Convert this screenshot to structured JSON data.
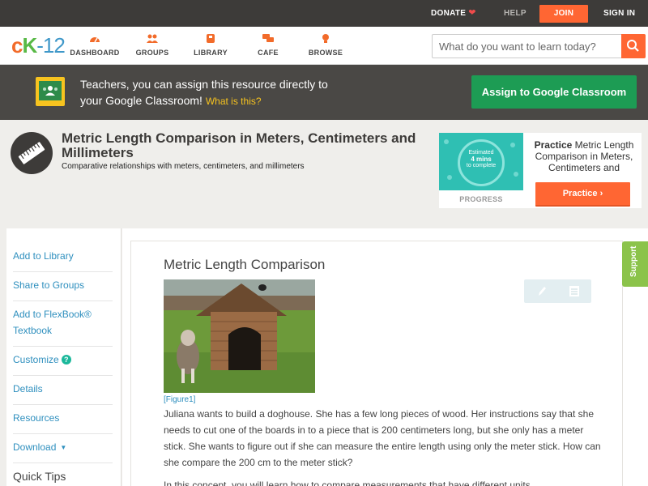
{
  "topbar": {
    "donate": "DONATE",
    "help": "HELP",
    "join": "JOIN",
    "signin": "SIGN IN"
  },
  "logo": {
    "c": "c",
    "k": "K",
    "n": "-12"
  },
  "nav": {
    "items": [
      {
        "label": "DASHBOARD",
        "icon": "dashboard-icon"
      },
      {
        "label": "GROUPS",
        "icon": "groups-icon"
      },
      {
        "label": "LIBRARY",
        "icon": "library-icon"
      },
      {
        "label": "CAFE",
        "icon": "cafe-icon"
      },
      {
        "label": "BROWSE",
        "icon": "browse-icon"
      }
    ],
    "search_placeholder": "What do you want to learn today?"
  },
  "classroom": {
    "line1": "Teachers, you can assign this resource directly to",
    "line2": "your Google Classroom!",
    "what": "What is this?",
    "button": "Assign to Google Classroom"
  },
  "lesson": {
    "title": "Metric Length Comparison in Meters, Centimeters and Millimeters",
    "subtitle": "Comparative relationships with meters, centimeters, and millimeters"
  },
  "practice": {
    "estimated": "Estimated",
    "mins": "4 mins",
    "complete": "to complete",
    "progress": "PROGRESS",
    "bold": "Practice",
    "text": "Metric Length Comparison in Meters, Centimeters and",
    "button": "Practice"
  },
  "sidebar": {
    "items": [
      {
        "label": "Add to Library"
      },
      {
        "label": "Share to Groups"
      },
      {
        "label": "Add to FlexBook® Textbook"
      },
      {
        "label": "Customize"
      },
      {
        "label": "Details"
      },
      {
        "label": "Resources"
      },
      {
        "label": "Download"
      }
    ],
    "quick_tips": "Quick Tips"
  },
  "content": {
    "title": "Metric Length Comparison",
    "figure_caption": "[Figure1]",
    "para1": "Juliana wants to build a doghouse. She has a few long pieces of wood. Her instructions say that she needs to cut one of the boards in to a piece that is 200 centimeters long, but she only has a meter stick. She wants to figure out if she can measure the entire length using only the meter stick. How can she compare the 200 cm to the meter stick?",
    "para2": "In this concept, you will learn how to compare measurements that have different units."
  },
  "support": "Support",
  "colors": {
    "accent": "#ff6633",
    "link": "#2e8fbe",
    "classroom_green": "#1d9c54",
    "support_green": "#8bc34a"
  }
}
